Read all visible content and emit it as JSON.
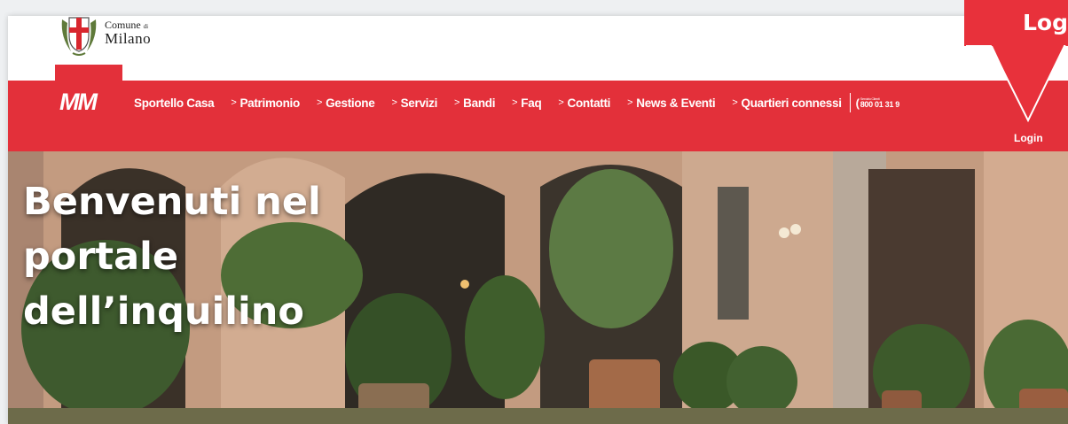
{
  "brand": {
    "comune_small": "Comune",
    "comune_di": "di",
    "comune_big": "Milano",
    "mm_logo": "MM"
  },
  "nav": {
    "items": [
      {
        "label": "Sportello Casa",
        "chevron": ""
      },
      {
        "label": "Patrimonio",
        "chevron": ">"
      },
      {
        "label": "Gestione",
        "chevron": ">"
      },
      {
        "label": "Servizi",
        "chevron": ">"
      },
      {
        "label": "Bandi",
        "chevron": ">"
      },
      {
        "label": "Faq",
        "chevron": ">"
      },
      {
        "label": "Contatti",
        "chevron": ">"
      },
      {
        "label": "News & Eventi",
        "chevron": ">"
      },
      {
        "label": "Quartieri connessi",
        "chevron": ">"
      }
    ],
    "phone_caption": "Servizio Clienti",
    "phone_number": "800 01 31 9",
    "login": "Login"
  },
  "hero": {
    "line1": "Benvenuti nel",
    "line2": "portale",
    "line3": "dell’inquilino"
  },
  "callout": {
    "text": "Log"
  },
  "colors": {
    "brand_red": "#e3303a",
    "white": "#ffffff"
  }
}
